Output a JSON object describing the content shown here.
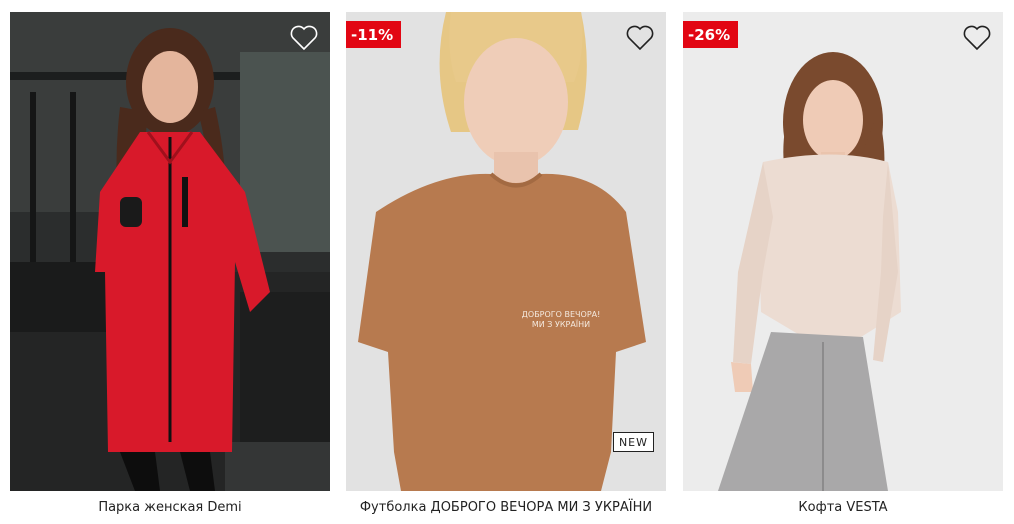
{
  "products": [
    {
      "title": "Парка женская Demi",
      "badge": "",
      "new_tag": "",
      "wishlist_icon": "heart-outline-icon",
      "colors": {
        "main": "#d8192a"
      }
    },
    {
      "title": "Футболка ДОБРОГО ВЕЧОРА МИ З УКРАЇНИ",
      "badge": "-11%",
      "new_tag": "NEW",
      "print_text": "ДОБРОГО ВЕЧОРА! МИ З УКРАЇНИ",
      "wishlist_icon": "heart-outline-icon",
      "colors": {
        "main": "#b77a4f"
      }
    },
    {
      "title": "Кофта VESTA",
      "badge": "-26%",
      "new_tag": "",
      "wishlist_icon": "heart-outline-icon",
      "colors": {
        "main": "#ecdcd2"
      }
    }
  ],
  "colors": {
    "badge": "#e20613",
    "background": "#ffffff"
  }
}
